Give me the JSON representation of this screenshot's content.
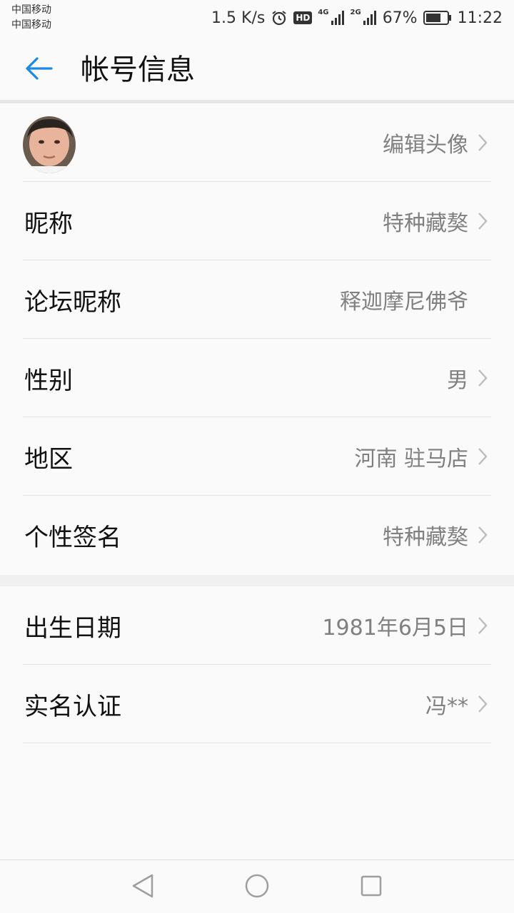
{
  "status_bar": {
    "carrier1": "中国移动",
    "carrier2": "中国移动",
    "speed": "1.5 K/s",
    "hd": "HD",
    "net1": "4G",
    "net2": "2G",
    "battery": "67%",
    "time": "11:22"
  },
  "header": {
    "title": "帐号信息"
  },
  "rows_group1": [
    {
      "label": "",
      "value": "编辑头像",
      "chevron": true
    },
    {
      "label": "昵称",
      "value": "特种藏獒",
      "chevron": true
    },
    {
      "label": "论坛昵称",
      "value": "释迦摩尼佛爷",
      "chevron": false
    },
    {
      "label": "性别",
      "value": "男",
      "chevron": true
    },
    {
      "label": "地区",
      "value": "河南 驻马店",
      "chevron": true
    },
    {
      "label": "个性签名",
      "value": "特种藏獒",
      "chevron": true
    }
  ],
  "rows_group2": [
    {
      "label": "出生日期",
      "value": "1981年6月5日",
      "chevron": true
    },
    {
      "label": "实名认证",
      "value": "冯**",
      "chevron": true
    }
  ],
  "colors": {
    "accent": "#1e88e5",
    "value_text": "#808080",
    "divider": "#e3e3e3"
  }
}
